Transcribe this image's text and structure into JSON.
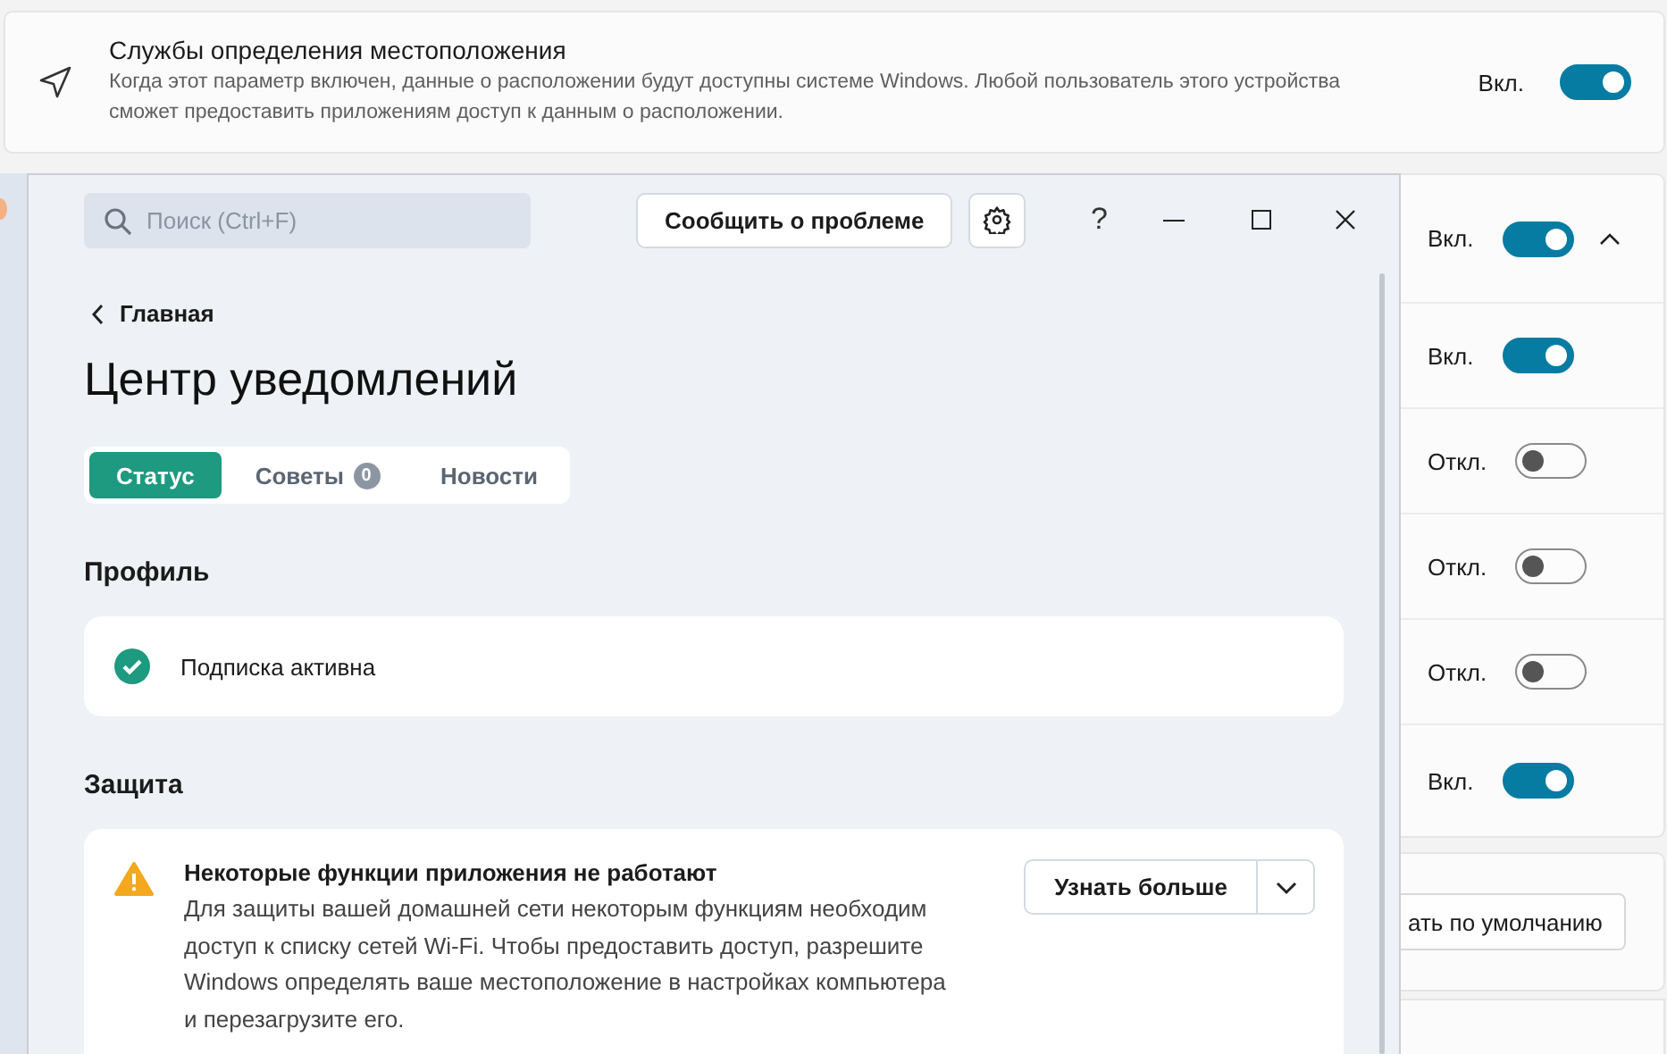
{
  "location_card": {
    "title": "Службы определения местоположения",
    "description": "Когда этот параметр включен, данные о расположении будут доступны системе Windows. Любой пользователь этого устройства сможет предоставить приложениям доступ к данным о расположении.",
    "state_label": "Вкл.",
    "on": true
  },
  "settings_rows": [
    {
      "kind": "expandable",
      "state_label": "Вкл.",
      "on": true,
      "expanded": true
    },
    {
      "kind": "toggle",
      "state_label": "Вкл.",
      "on": true
    },
    {
      "kind": "toggle",
      "state_label": "Откл.",
      "on": false
    },
    {
      "kind": "toggle",
      "state_label": "Откл.",
      "on": false
    },
    {
      "kind": "toggle",
      "state_label": "Откл.",
      "on": false
    },
    {
      "kind": "toggle",
      "state_label": "Вкл.",
      "on": true
    }
  ],
  "reset_button": {
    "label": "ать по умолчанию"
  },
  "app": {
    "search": {
      "placeholder": "Поиск (Ctrl+F)"
    },
    "report_button": "Сообщить о проблеме",
    "help_label": "?",
    "breadcrumb": "Главная",
    "title": "Центр уведомлений",
    "tabs": [
      {
        "label": "Статус",
        "selected": true
      },
      {
        "label": "Советы",
        "badge": "0",
        "selected": false
      },
      {
        "label": "Новости",
        "selected": false
      }
    ],
    "sections": [
      {
        "title": "Профиль",
        "items": [
          {
            "kind": "status",
            "text": "Подписка активна"
          }
        ]
      },
      {
        "title": "Защита",
        "items": [
          {
            "kind": "alert",
            "title": "Некоторые функции приложения не работают",
            "body": "Для защиты вашей домашней сети некоторым функциям необходим доступ к списку сетей Wi-Fi. Чтобы предоставить доступ, разрешите Windows определять ваше местоположение в настройках компьютера и перезагрузите его.",
            "action": "Узнать больше"
          }
        ]
      }
    ]
  }
}
